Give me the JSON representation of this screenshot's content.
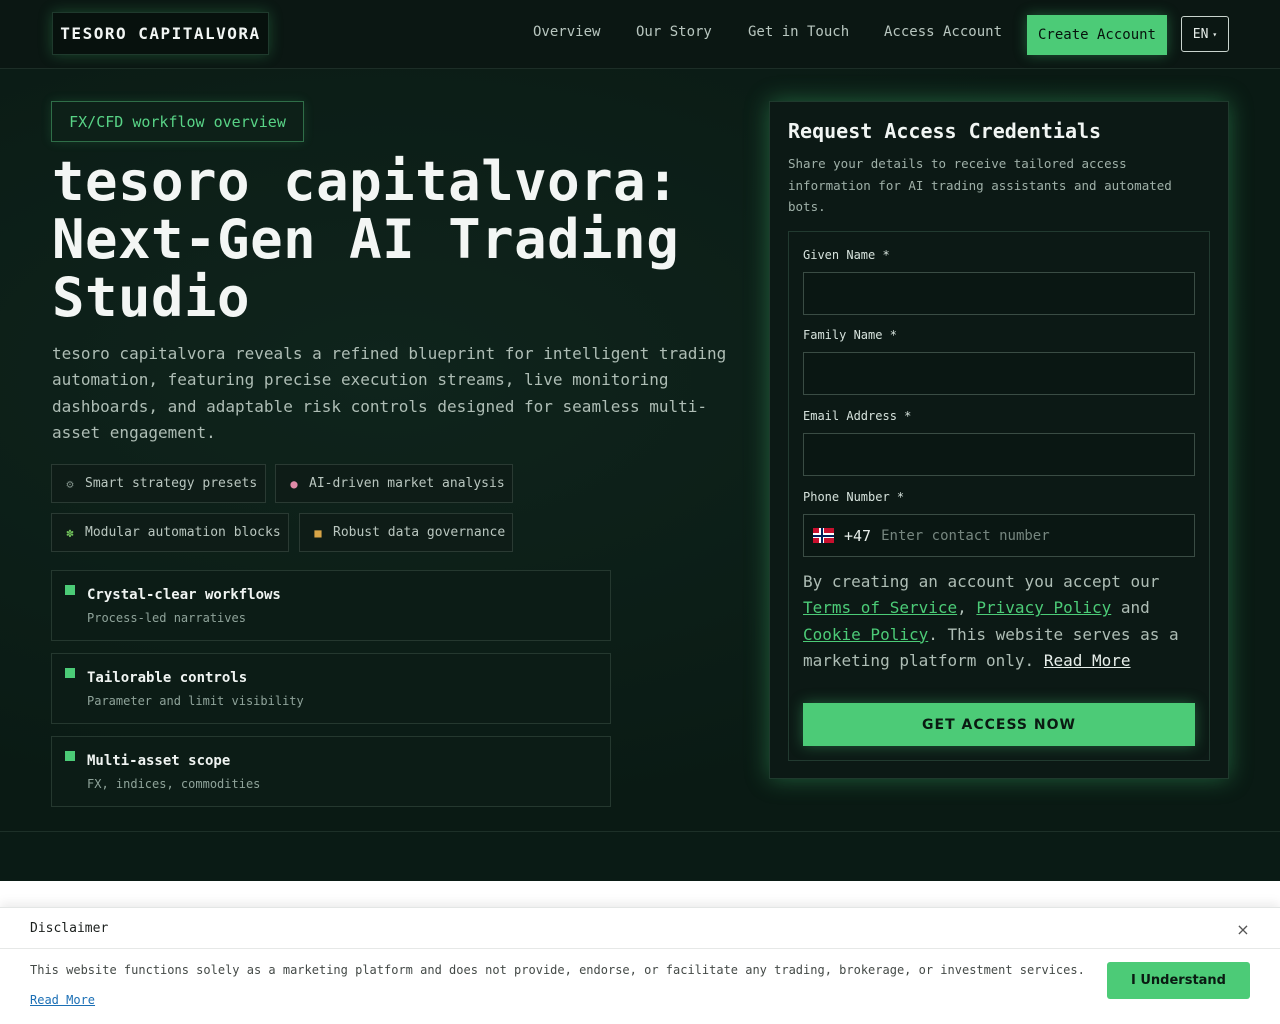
{
  "header": {
    "logo": "TESORO CAPITALVORA",
    "nav": [
      "Overview",
      "Our Story",
      "Get in Touch",
      "Access Account"
    ],
    "create_label": "Create Account",
    "lang": "EN",
    "lang_caret": "▾"
  },
  "hero": {
    "pill": "FX/CFD workflow overview",
    "title_lines": [
      "tesoro capitalvora:",
      "Next-Gen AI Trading",
      "Studio"
    ],
    "description": "tesoro capitalvora reveals a refined blueprint for intelligent trading automation, featuring precise execution streams, live monitoring dashboards, and adaptable risk controls designed for seamless multi-asset engagement.",
    "chips": [
      {
        "icon": "⚙",
        "label": "Smart strategy presets"
      },
      {
        "icon": "●",
        "label": "AI-driven market analysis"
      },
      {
        "icon": "✽",
        "label": "Modular automation blocks"
      },
      {
        "icon": "■",
        "label": "Robust data governance"
      }
    ],
    "cards": [
      {
        "title": "Crystal-clear workflows",
        "subtitle": "Process-led narratives"
      },
      {
        "title": "Tailorable controls",
        "subtitle": "Parameter and limit visibility"
      },
      {
        "title": "Multi-asset scope",
        "subtitle": "FX, indices, commodities"
      }
    ]
  },
  "form": {
    "title": "Request Access Credentials",
    "subtitle": "Share your details to receive tailored access information for AI trading assistants and automated bots.",
    "given_label": "Given Name *",
    "family_label": "Family Name *",
    "email_label": "Email Address *",
    "phone_label": "Phone Number *",
    "dial_code": "+47",
    "phone_placeholder": "Enter contact number",
    "consent_prefix": "By creating an account you accept our",
    "terms": "Terms of Service",
    "privacy": "Privacy Policy",
    "and": "and",
    "cookie": "Cookie Policy",
    "consent_suffix": ". This website serves as a marketing platform only.",
    "read_more": "Read More",
    "submit": "GET ACCESS NOW"
  },
  "disclaimer": {
    "title": "Disclaimer",
    "close": "×",
    "text": "This website functions solely as a marketing platform and does not provide, endorse, or facilitate any trading, brokerage, or investment services.",
    "read_more": "Read More",
    "button": "I Understand"
  },
  "colors": {
    "accent": "#4ccb77",
    "background": "#0a1a14",
    "panel": "#0c1915"
  }
}
